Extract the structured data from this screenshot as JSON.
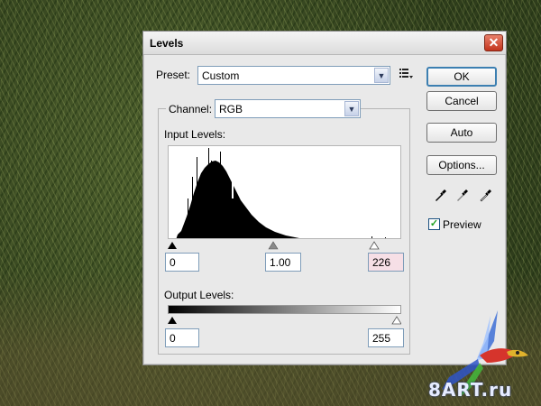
{
  "window": {
    "title": "Levels",
    "close_glyph": "✕"
  },
  "preset": {
    "label": "Preset:",
    "value": "Custom",
    "menu_icon": "list-options-icon"
  },
  "channel": {
    "label": "Channel:",
    "value": "RGB"
  },
  "input_levels": {
    "label": "Input Levels:",
    "black": "0",
    "gamma": "1.00",
    "white": "226",
    "white_highlight_color": "#f6dfe6"
  },
  "output_levels": {
    "label": "Output Levels:",
    "black": "0",
    "white": "255"
  },
  "buttons": {
    "ok": "OK",
    "cancel": "Cancel",
    "auto": "Auto",
    "options": "Options..."
  },
  "preview": {
    "label": "Preview",
    "checked": true
  },
  "eyedroppers": [
    "black-eyedropper-icon",
    "gray-eyedropper-icon",
    "white-eyedropper-icon"
  ],
  "watermark": {
    "text": "8ART.ru"
  }
}
